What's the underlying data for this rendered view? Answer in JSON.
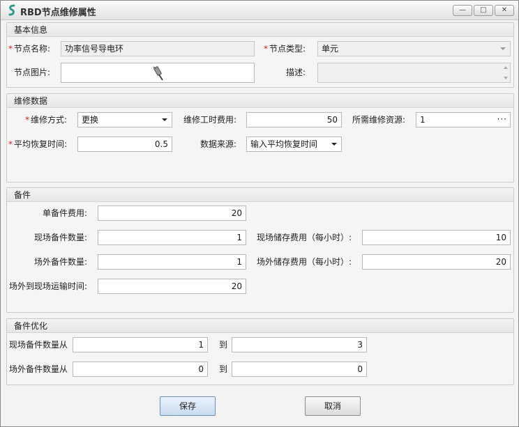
{
  "window": {
    "title": "RBD节点维修属性",
    "minimize": "—",
    "maximize": "□",
    "close": "✕"
  },
  "basic": {
    "header": "基本信息",
    "node_name_label": "节点名称:",
    "node_name_value": "功率信号导电环",
    "node_type_label": "节点类型:",
    "node_type_value": "单元",
    "node_image_label": "节点图片:",
    "desc_label": "描述:"
  },
  "repair": {
    "header": "维修数据",
    "method_label": "维修方式:",
    "method_value": "更换",
    "labor_cost_label": "维修工时费用:",
    "labor_cost_value": "50",
    "resource_label": "所需维修资源:",
    "resource_value": "1",
    "resource_btn": "···",
    "mttr_label": "平均恢复时间:",
    "mttr_value": "0.5",
    "source_label": "数据来源:",
    "source_value": "输入平均恢复时间"
  },
  "spares": {
    "header": "备件",
    "unit_cost_label": "单备件费用:",
    "unit_cost_value": "20",
    "onsite_qty_label": "现场备件数量:",
    "onsite_qty_value": "1",
    "onsite_storage_label": "现场储存费用（每小时）:",
    "onsite_storage_value": "10",
    "offsite_qty_label": "场外备件数量:",
    "offsite_qty_value": "1",
    "offsite_storage_label": "场外储存费用（每小时）:",
    "offsite_storage_value": "20",
    "transport_label": "场外到现场运输时间:",
    "transport_value": "20"
  },
  "optimize": {
    "header": "备件优化",
    "onsite_from_label": "现场备件数量从",
    "onsite_from_value": "1",
    "onsite_to_label": "到",
    "onsite_to_value": "3",
    "offsite_from_label": "场外备件数量从",
    "offsite_from_value": "0",
    "offsite_to_label": "到",
    "offsite_to_value": "0"
  },
  "actions": {
    "save": "保存",
    "cancel": "取消"
  },
  "colors": {
    "required_mark": "#d02020",
    "app_icon": "#2a9d8f"
  },
  "icons": {
    "app": "app-logo-icon",
    "node_image": "connector-icon"
  }
}
